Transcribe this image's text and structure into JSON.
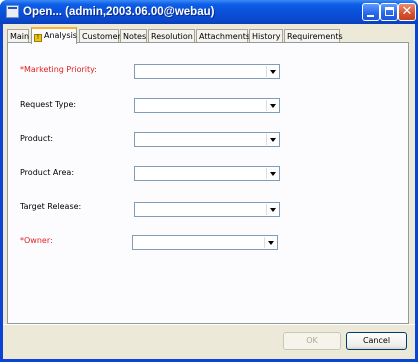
{
  "window": {
    "title": "Open... (admin,2003.06.00@webau)",
    "minimize_icon": "minimize-icon",
    "maximize_icon": "maximize-icon",
    "close_icon": "close-icon"
  },
  "tabs": [
    {
      "label": "Main"
    },
    {
      "label": "Analysis",
      "icon": "warning-icon",
      "active": true
    },
    {
      "label": "Customer"
    },
    {
      "label": "Notes"
    },
    {
      "label": "Resolution"
    },
    {
      "label": "Attachments"
    },
    {
      "label": "History"
    },
    {
      "label": "Requirements"
    }
  ],
  "form": {
    "fields": [
      {
        "label": "*Marketing Priority:",
        "required": true,
        "value": ""
      },
      {
        "label": "Request Type:",
        "required": false,
        "value": ""
      },
      {
        "label": "Product:",
        "required": false,
        "value": ""
      },
      {
        "label": "Product Area:",
        "required": false,
        "value": ""
      },
      {
        "label": "Target Release:",
        "required": false,
        "value": ""
      },
      {
        "label": "*Owner:",
        "required": true,
        "value": ""
      }
    ]
  },
  "buttons": {
    "ok": "OK",
    "cancel": "Cancel"
  },
  "colors": {
    "required_label": "#e02020",
    "titlebar": "#0a4fd8",
    "dialog_bg": "#ece9d8"
  }
}
